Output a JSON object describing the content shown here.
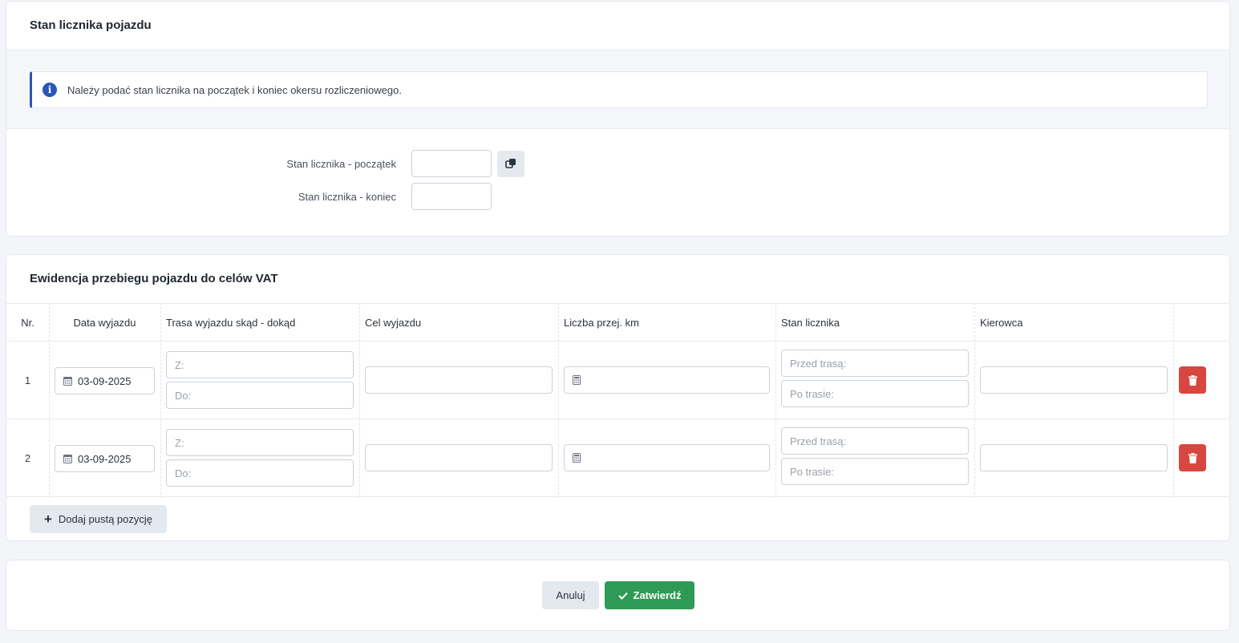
{
  "meter_section": {
    "title": "Stan licznika pojazdu",
    "info_text": "Należy podać stan licznika na początek i koniec okersu rozliczeniowego.",
    "start_label": "Stan licznika - początek",
    "end_label": "Stan licznika - koniec",
    "start_value": "",
    "end_value": ""
  },
  "mileage_section": {
    "title": "Ewidencja przebiegu pojazdu do celów VAT",
    "columns": {
      "nr": "Nr.",
      "date": "Data wyjazdu",
      "route": "Trasa wyjazdu skąd - dokąd",
      "purpose": "Cel wyjazdu",
      "km": "Liczba przej. km",
      "meter": "Stan licznika",
      "driver": "Kierowca"
    },
    "rows": [
      {
        "nr": "1",
        "date": "03-09-2025",
        "from_placeholder": "Z:",
        "to_placeholder": "Do:",
        "purpose": "",
        "km": "",
        "meter_before_placeholder": "Przed trasą:",
        "meter_after_placeholder": "Po trasie:",
        "driver": ""
      },
      {
        "nr": "2",
        "date": "03-09-2025",
        "from_placeholder": "Z:",
        "to_placeholder": "Do:",
        "purpose": "",
        "km": "",
        "meter_before_placeholder": "Przed trasą:",
        "meter_after_placeholder": "Po trasie:",
        "driver": ""
      }
    ],
    "add_button": "Dodaj pustą pozycję"
  },
  "actions": {
    "cancel": "Anuluj",
    "confirm": "Zatwierdź"
  },
  "colors": {
    "accent_blue": "#2b56b8",
    "danger": "#d8473f",
    "success": "#2f9a55"
  },
  "icons": {
    "info": "info-circle-icon",
    "copy": "copy-icon",
    "calendar": "calendar-icon",
    "calculator": "calculator-icon",
    "delete": "trash-icon",
    "add": "plus-icon",
    "confirm": "check-icon"
  }
}
